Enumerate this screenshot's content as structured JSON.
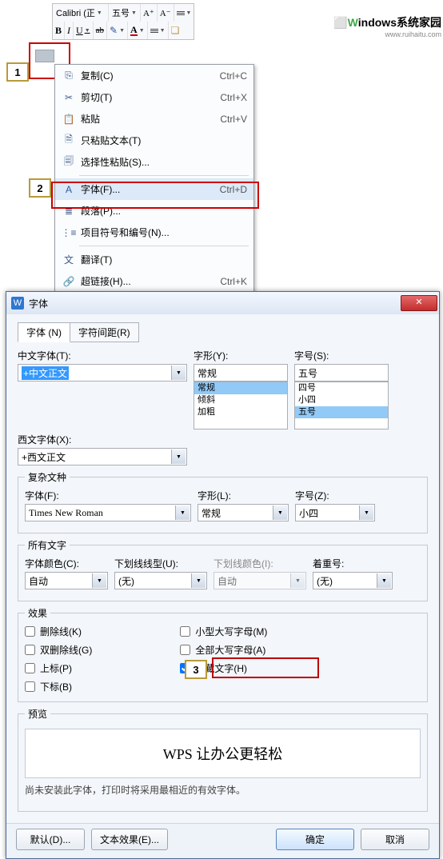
{
  "toolbar": {
    "font_name": "Calibri (正",
    "font_size": "五号",
    "inc_font": "A⁺",
    "dec_font": "A⁻",
    "bold": "B",
    "italic": "I",
    "underline": "U",
    "strike": "ab",
    "font_color": "A"
  },
  "steps": {
    "s1": "1",
    "s2": "2",
    "s3": "3"
  },
  "ctx": {
    "copy": "复制(C)",
    "copy_sc": "Ctrl+C",
    "cut": "剪切(T)",
    "cut_sc": "Ctrl+X",
    "paste": "粘贴",
    "paste_sc": "Ctrl+V",
    "paste_text": "只粘贴文本(T)",
    "paste_special": "选择性粘贴(S)...",
    "font": "字体(F)...",
    "font_sc": "Ctrl+D",
    "paragraph": "段落(P)...",
    "bullets": "项目符号和编号(N)...",
    "translate": "翻译(T)",
    "hyperlink": "超链接(H)...",
    "hyperlink_sc": "Ctrl+K"
  },
  "dlg": {
    "title": "字体",
    "tab_font": "字体 (N)",
    "tab_spacing": "字符间距(R)",
    "cn_font_lbl": "中文字体(T):",
    "cn_font_val": "+中文正文",
    "west_font_lbl": "西文字体(X):",
    "west_font_val": "+西文正文",
    "style_lbl": "字形(Y):",
    "style_val": "常规",
    "styles": [
      "常规",
      "倾斜",
      "加粗"
    ],
    "size_lbl": "字号(S):",
    "size_val": "五号",
    "sizes": [
      "四号",
      "小四",
      "五号"
    ],
    "complex_legend": "复杂文种",
    "cx_font_lbl": "字体(F):",
    "cx_font_val": "Times New Roman",
    "cx_style_lbl": "字形(L):",
    "cx_style_val": "常规",
    "cx_size_lbl": "字号(Z):",
    "cx_size_val": "小四",
    "all_text_legend": "所有文字",
    "color_lbl": "字体颜色(C):",
    "color_val": "自动",
    "uline_lbl": "下划线线型(U):",
    "uline_val": "(无)",
    "ucolor_lbl": "下划线颜色(I):",
    "ucolor_val": "自动",
    "emph_lbl": "着重号:",
    "emph_val": "(无)",
    "effects_legend": "效果",
    "strike": "删除线(K)",
    "dstrike": "双删除线(G)",
    "sup": "上标(P)",
    "sub": "下标(B)",
    "smallcaps": "小型大写字母(M)",
    "allcaps": "全部大写字母(A)",
    "hidden": "隐藏文字(H)",
    "preview_legend": "预览",
    "preview_text": "WPS 让办公更轻松",
    "note": "尚未安装此字体，打印时将采用最相近的有效字体。",
    "btn_default": "默认(D)...",
    "btn_texteffect": "文本效果(E)...",
    "btn_ok": "确定",
    "btn_cancel": "取消"
  },
  "watermark": {
    "main": "indows系统家园",
    "sub": "www.ruihaitu.com"
  }
}
